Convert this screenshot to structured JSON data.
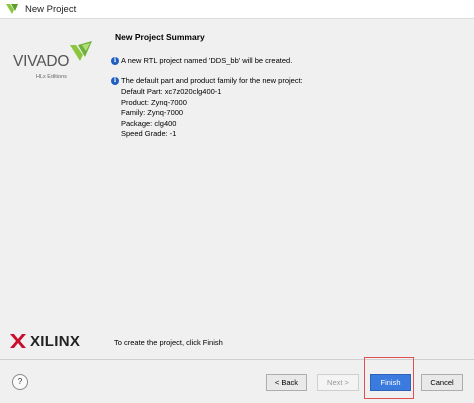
{
  "window": {
    "title": "New Project"
  },
  "brand": {
    "vivado_text": "VIVADO",
    "vivado_subtext": "HLx Editions",
    "xilinx_text": "XILINX",
    "accent_green": "#8cc63e",
    "accent_red": "#c8102e"
  },
  "summary": {
    "title": "New Project Summary",
    "rtl_message": "A new RTL project named 'DDS_bb' will be created.",
    "part_intro": "The default part and product family for the new project:",
    "details": [
      "Default Part: xc7z020clg400-1",
      "Product: Zynq-7000",
      "Family: Zynq-7000",
      "Package: clg400",
      "Speed Grade: -1"
    ],
    "footer": "To create the project, click Finish"
  },
  "buttons": {
    "help": "?",
    "back": "< Back",
    "next": "Next >",
    "finish": "Finish",
    "cancel": "Cancel"
  }
}
